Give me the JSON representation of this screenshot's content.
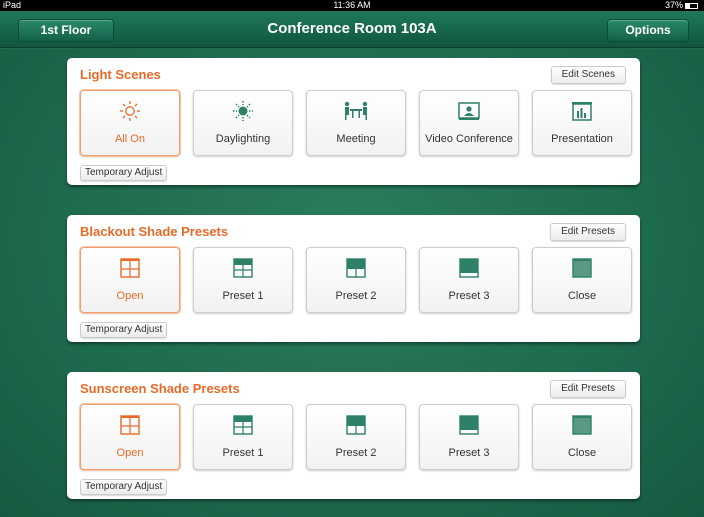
{
  "status_bar": {
    "device": "iPad",
    "time": "11:36 AM",
    "battery": "37%"
  },
  "nav": {
    "left_button": "1st Floor",
    "title": "Conference Room 103A",
    "right_button": "Options"
  },
  "panels": [
    {
      "title": "Light Scenes",
      "edit_label": "Edit Scenes",
      "temp_label": "Temporary Adjust",
      "tiles": [
        {
          "label": "All On",
          "icon": "sun-icon",
          "active": true
        },
        {
          "label": "Daylighting",
          "icon": "daylight-icon",
          "active": false
        },
        {
          "label": "Meeting",
          "icon": "meeting-icon",
          "active": false
        },
        {
          "label": "Video Conference",
          "icon": "video-conference-icon",
          "active": false
        },
        {
          "label": "Presentation",
          "icon": "presentation-icon",
          "active": false
        }
      ]
    },
    {
      "title": "Blackout Shade Presets",
      "edit_label": "Edit Presets",
      "temp_label": "Temporary Adjust",
      "tiles": [
        {
          "label": "Open",
          "icon": "shade-open-icon",
          "active": true
        },
        {
          "label": "Preset 1",
          "icon": "shade-preset1-icon",
          "active": false
        },
        {
          "label": "Preset 2",
          "icon": "shade-preset2-icon",
          "active": false
        },
        {
          "label": "Preset 3",
          "icon": "shade-preset3-icon",
          "active": false
        },
        {
          "label": "Close",
          "icon": "shade-closed-icon",
          "active": false
        }
      ]
    },
    {
      "title": "Sunscreen Shade Presets",
      "edit_label": "Edit Presets",
      "temp_label": "Temporary Adjust",
      "tiles": [
        {
          "label": "Open",
          "icon": "shade-open-icon",
          "active": true
        },
        {
          "label": "Preset 1",
          "icon": "shade-preset1-icon",
          "active": false
        },
        {
          "label": "Preset 2",
          "icon": "shade-preset2-icon",
          "active": false
        },
        {
          "label": "Preset 3",
          "icon": "shade-preset3-icon",
          "active": false
        },
        {
          "label": "Close",
          "icon": "shade-closed-icon",
          "active": false
        }
      ]
    }
  ],
  "colors": {
    "accent": "#e66b2a",
    "icon_green": "#2e8066",
    "background": "#1f6b4e"
  }
}
